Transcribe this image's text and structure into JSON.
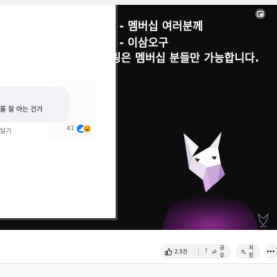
{
  "video": {
    "captions": [
      "- - 멤버십 여러분께",
      "- - 이삼오구",
      "링은 멤버십 분들만 가능합니다."
    ],
    "embedded_comment": {
      "text": "를 잘 아는 건가",
      "reply_label": "달기",
      "reaction_count": "41"
    }
  },
  "actions": {
    "like_count": "2.5천",
    "share_label": "공유",
    "save_label": "저장"
  },
  "colors": {
    "video_bg": "#0d0d0d",
    "caption": "#ffffff",
    "pill_bg": "#f2f2f2",
    "mask_accent": "#c060d0"
  },
  "icons": {
    "corner": "miniplayer-icon",
    "like": "thumbs-up-icon",
    "dislike": "thumbs-down-icon",
    "share": "share-arrow-icon",
    "save": "save-list-icon",
    "more": "more-horizontal-icon"
  }
}
